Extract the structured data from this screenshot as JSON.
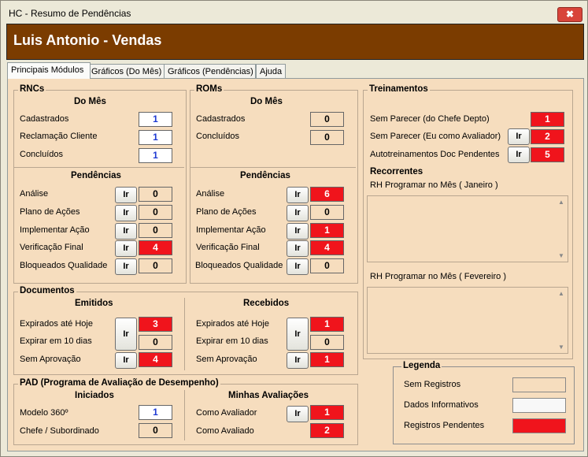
{
  "window": {
    "title": "HC - Resumo de Pendências",
    "close_glyph": "✖"
  },
  "header": {
    "title": "Luis Antonio - Vendas"
  },
  "tabs": [
    "Principais Módulos",
    "Gráficos (Do Mês)",
    "Gráficos (Pendências)",
    "Ajuda"
  ],
  "ir_label": "Ir",
  "rncs": {
    "title": "RNCs",
    "do_mes_title": "Do Mês",
    "do_mes": [
      {
        "label": "Cadastrados",
        "value": "1"
      },
      {
        "label": "Reclamação Cliente",
        "value": "1"
      },
      {
        "label": "Concluídos",
        "value": "1"
      }
    ],
    "pend_title": "Pendências",
    "pendencias": [
      {
        "label": "Análise",
        "value": "0"
      },
      {
        "label": "Plano de Ações",
        "value": "0"
      },
      {
        "label": "Implementar Ação",
        "value": "0"
      },
      {
        "label": "Verificação Final",
        "value": "4"
      },
      {
        "label": "Bloqueados Qualidade",
        "value": "0"
      }
    ]
  },
  "roms": {
    "title": "ROMs",
    "do_mes_title": "Do Mês",
    "do_mes": [
      {
        "label": "Cadastrados",
        "value": "0"
      },
      {
        "label": "Concluídos",
        "value": "0"
      }
    ],
    "pend_title": "Pendências",
    "pendencias": [
      {
        "label": "Análise",
        "value": "6"
      },
      {
        "label": "Plano de Ações",
        "value": "0"
      },
      {
        "label": "Implementar Ação",
        "value": "1"
      },
      {
        "label": "Verificação Final",
        "value": "4"
      },
      {
        "label": "Bloqueados Qualidade",
        "value": "0"
      }
    ]
  },
  "documentos": {
    "title": "Documentos",
    "emitidos_title": "Emitidos",
    "emitidos": [
      {
        "label": "Expirados até Hoje",
        "value": "3"
      },
      {
        "label": "Expirar em 10 dias",
        "value": "0"
      },
      {
        "label": "Sem Aprovação",
        "value": "4"
      }
    ],
    "recebidos_title": "Recebidos",
    "recebidos": [
      {
        "label": "Expirados até Hoje",
        "value": "1"
      },
      {
        "label": "Expirar em 10 dias",
        "value": "0"
      },
      {
        "label": "Sem Aprovação",
        "value": "1"
      }
    ]
  },
  "pad": {
    "title": "PAD (Programa de Avaliação de Desempenho)",
    "iniciados_title": "Iniciados",
    "iniciados": [
      {
        "label": "Modelo 360º",
        "value": "1"
      },
      {
        "label": "Chefe / Subordinado",
        "value": "0"
      }
    ],
    "minhas_title": "Minhas Avaliações",
    "minhas": [
      {
        "label": "Como Avaliador",
        "value": "1"
      },
      {
        "label": "Como Avaliado",
        "value": "2"
      }
    ]
  },
  "treinamentos": {
    "title": "Treinamentos",
    "items": [
      {
        "label": "Sem Parecer (do Chefe Depto)",
        "value": "1"
      },
      {
        "label": "Sem Parecer (Eu como Avaliador)",
        "value": "2"
      },
      {
        "label": "Autotreinamentos Doc Pendentes",
        "value": "5"
      }
    ],
    "recorrentes_title": "Recorrentes",
    "list1_label": "RH Programar no Mês ( Janeiro )",
    "list2_label": "RH Programar no Mês ( Fevereiro )"
  },
  "legenda": {
    "title": "Legenda",
    "items": [
      {
        "label": "Sem Registros",
        "color": "#f6ddbe"
      },
      {
        "label": "Dados Informativos",
        "color": "#f8f8f8"
      },
      {
        "label": "Registros Pendentes",
        "color": "#f0141c"
      }
    ]
  },
  "colors": {
    "header_bg": "#7b3c00",
    "panel_bg": "#f6ddbe",
    "pending": "#f0141c",
    "info_text": "#1f3bd3"
  }
}
